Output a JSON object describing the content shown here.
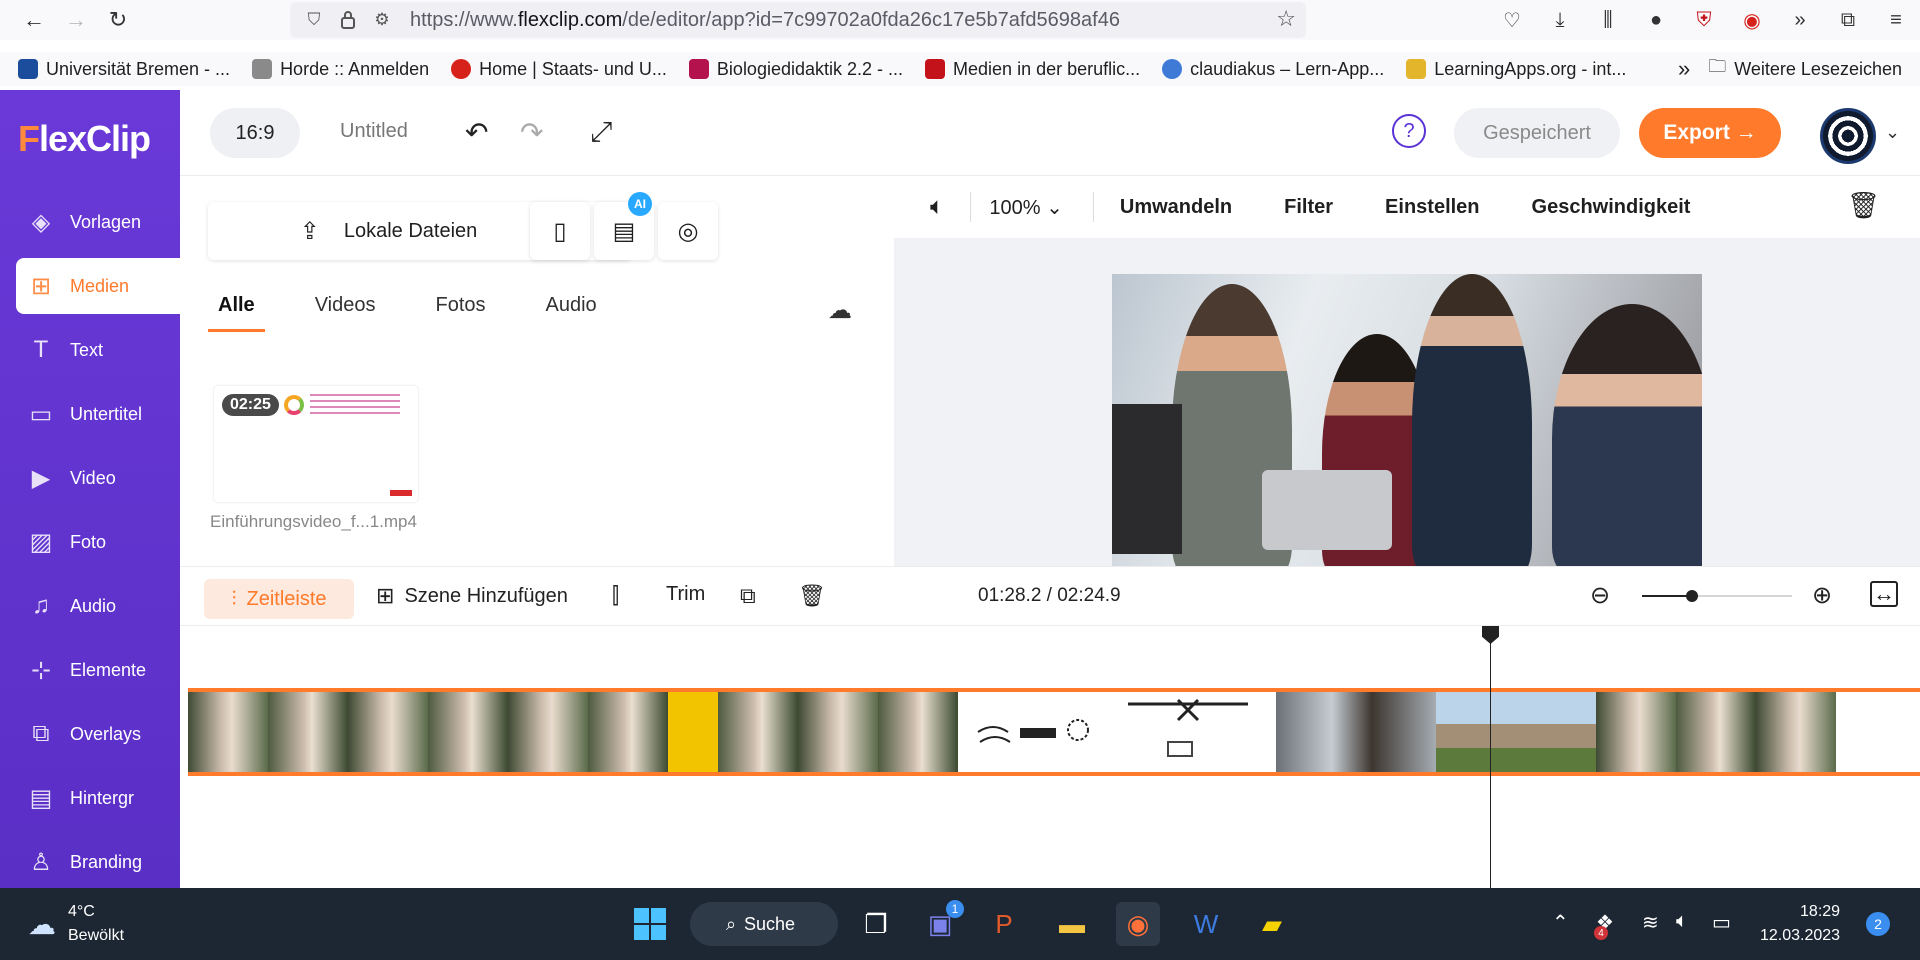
{
  "browser": {
    "url_prefix": "https://www.",
    "url_domain": "flexclip.com",
    "url_path": "/de/editor/app?id=7c99702a0fda26c17e5b7afd5698af46",
    "bookmarks": [
      {
        "label": "Universität Bremen - ...",
        "color": "#1b4d9c"
      },
      {
        "label": "Horde :: Anmelden",
        "color": "#8a8a8a"
      },
      {
        "label": "Home | Staats- und U...",
        "color": "#d6221a"
      },
      {
        "label": "Biologiedidaktik 2.2 - ...",
        "color": "#b3124d"
      },
      {
        "label": "Medien in der beruflic...",
        "color": "#c4121a"
      },
      {
        "label": "claudiakus – Lern-App...",
        "color": "#3f7ad6"
      },
      {
        "label": "LearningApps.org - int...",
        "color": "#e3b52a"
      }
    ],
    "bookmarks_more": "»",
    "other_bookmarks": "Weitere Lesezeichen"
  },
  "app": {
    "logo": "lexClip",
    "logo_f": "F",
    "ratio": "16:9",
    "title": "Untitled",
    "saved": "Gespeichert",
    "export": "Export →",
    "help": "?"
  },
  "sidebar": {
    "items": [
      {
        "label": "Vorlagen",
        "icon": "layers-icon"
      },
      {
        "label": "Medien",
        "icon": "media-icon"
      },
      {
        "label": "Text",
        "icon": "text-icon"
      },
      {
        "label": "Untertitel",
        "icon": "subtitle-icon"
      },
      {
        "label": "Video",
        "icon": "video-icon"
      },
      {
        "label": "Foto",
        "icon": "photo-icon"
      },
      {
        "label": "Audio",
        "icon": "music-icon"
      },
      {
        "label": "Elemente",
        "icon": "elements-icon"
      },
      {
        "label": "Overlays",
        "icon": "overlays-icon"
      },
      {
        "label": "Hintergr",
        "icon": "background-icon"
      },
      {
        "label": "Branding",
        "icon": "stamp-icon"
      }
    ]
  },
  "media": {
    "upload_label": "Lokale Dateien",
    "ai_badge": "AI",
    "tabs": [
      "Alle",
      "Videos",
      "Fotos",
      "Audio"
    ],
    "file": {
      "duration": "02:25",
      "name": "Einführungsvideo_f...1.mp4"
    }
  },
  "preview": {
    "zoom": "100%",
    "tools": [
      "Umwandeln",
      "Filter",
      "Einstellen",
      "Geschwindigkeit"
    ]
  },
  "timeline": {
    "zeitleiste": "Zeitleiste",
    "add_scene": "Szene Hinzufügen",
    "trim": "Trim",
    "timecode": "01:28.2 / 02:24.9",
    "zoom_level": 0.33
  },
  "taskbar": {
    "temp": "4°C",
    "weather": "Bewölkt",
    "search": "Suche",
    "teams_badge": "1",
    "time": "18:29",
    "date": "12.03.2023",
    "notifications": "2",
    "dropbox_badge": "4"
  }
}
